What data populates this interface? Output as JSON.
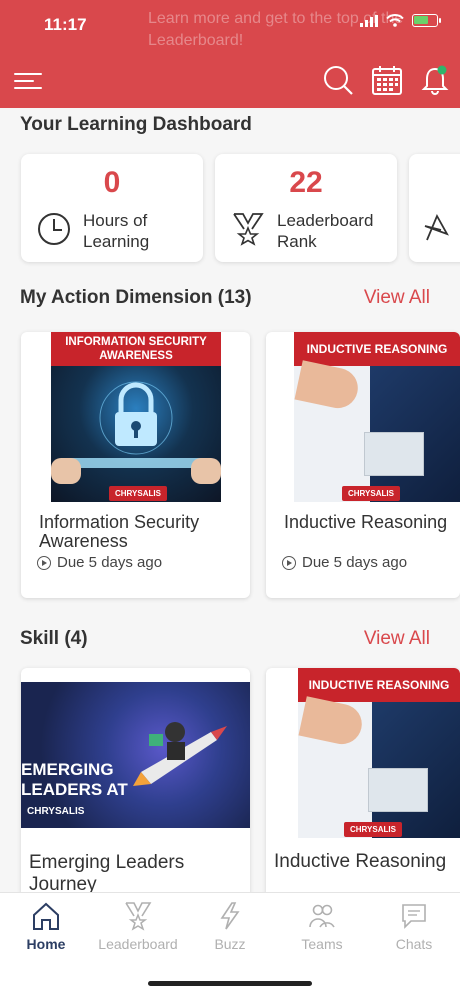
{
  "status_bar": {
    "time": "11:17"
  },
  "header": {
    "ghost_text": "Learn more and get to the top of the Leaderboard!",
    "icons": [
      "menu-icon",
      "search-icon",
      "calendar-icon",
      "bell-icon"
    ],
    "accent_color": "#d9484c"
  },
  "dashboard": {
    "title": "Your Learning Dashboard",
    "stats": [
      {
        "value": "0",
        "label": "Hours of Learning",
        "icon": "clock-icon"
      },
      {
        "value": "22",
        "label": "Leaderboard Rank",
        "icon": "medal-icon"
      }
    ]
  },
  "action_dimension": {
    "title": "My Action Dimension (13)",
    "view_all": "View All",
    "courses": [
      {
        "banner": "INFORMATION SECURITY AWARENESS",
        "title": "Information Security Awareness",
        "due": "Due 5 days ago",
        "brand": "CHRYSALIS"
      },
      {
        "banner": "INDUCTIVE REASONING",
        "title": "Inductive Reasoning",
        "due": "Due 5 days ago",
        "brand": "CHRYSALIS"
      }
    ]
  },
  "skill": {
    "title": "Skill (4)",
    "view_all": "View All",
    "courses": [
      {
        "banner": "EMERGING LEADERS AT",
        "title": "Emerging Leaders Journey",
        "brand": "CHRYSALIS"
      },
      {
        "banner": "INDUCTIVE REASONING",
        "title": "Inductive Reasoning",
        "brand": "CHRYSALIS"
      }
    ]
  },
  "bottom_nav": [
    {
      "label": "Home",
      "icon": "home-icon",
      "active": true
    },
    {
      "label": "Leaderboard",
      "icon": "medal-icon"
    },
    {
      "label": "Buzz",
      "icon": "bolt-icon"
    },
    {
      "label": "Teams",
      "icon": "team-icon"
    },
    {
      "label": "Chats",
      "icon": "chat-icon"
    }
  ]
}
